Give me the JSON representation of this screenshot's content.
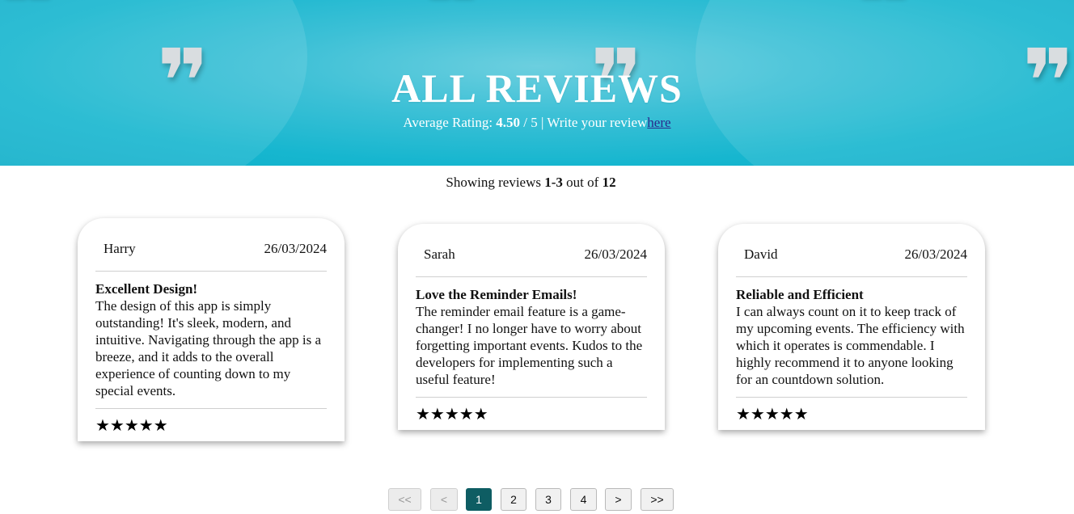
{
  "hero": {
    "title": "ALL REVIEWS",
    "avg_label": "Average Rating:",
    "avg_value": "4.50",
    "avg_suffix": "/ 5 | Write your review",
    "link_text": "here"
  },
  "summary": {
    "prefix": "Showing reviews",
    "range": "1-3",
    "middle": "out of",
    "total": "12"
  },
  "reviews": [
    {
      "name": "Harry",
      "date": "26/03/2024",
      "title": "Excellent Design!",
      "body": "The design of this app is simply outstanding! It's sleek, modern, and intuitive. Navigating through the app is a breeze, and it adds to the overall experience of counting down to my special events.",
      "rating": 5,
      "stars": "★★★★★"
    },
    {
      "name": "Sarah",
      "date": "26/03/2024",
      "title": "Love the Reminder Emails!",
      "body": "The reminder email feature is a game-changer! I no longer have to worry about forgetting important events. Kudos to the developers for implementing such a useful feature!",
      "rating": 5,
      "stars": "★★★★★"
    },
    {
      "name": "David",
      "date": "26/03/2024",
      "title": "Reliable and Efficient",
      "body": "I can always count on it to keep track of my upcoming events. The efficiency with which it operates is commendable. I highly recommend it to anyone looking for an countdown solution.",
      "rating": 5,
      "stars": "★★★★★"
    }
  ],
  "pagination": {
    "first": "<<",
    "prev": "<",
    "pages": [
      "1",
      "2",
      "3",
      "4"
    ],
    "current": "1",
    "next": ">",
    "last": ">>"
  },
  "colors": {
    "hero_bg": "#16b6cf",
    "active_page": "#0e5d63",
    "link": "#2a2a8c"
  }
}
